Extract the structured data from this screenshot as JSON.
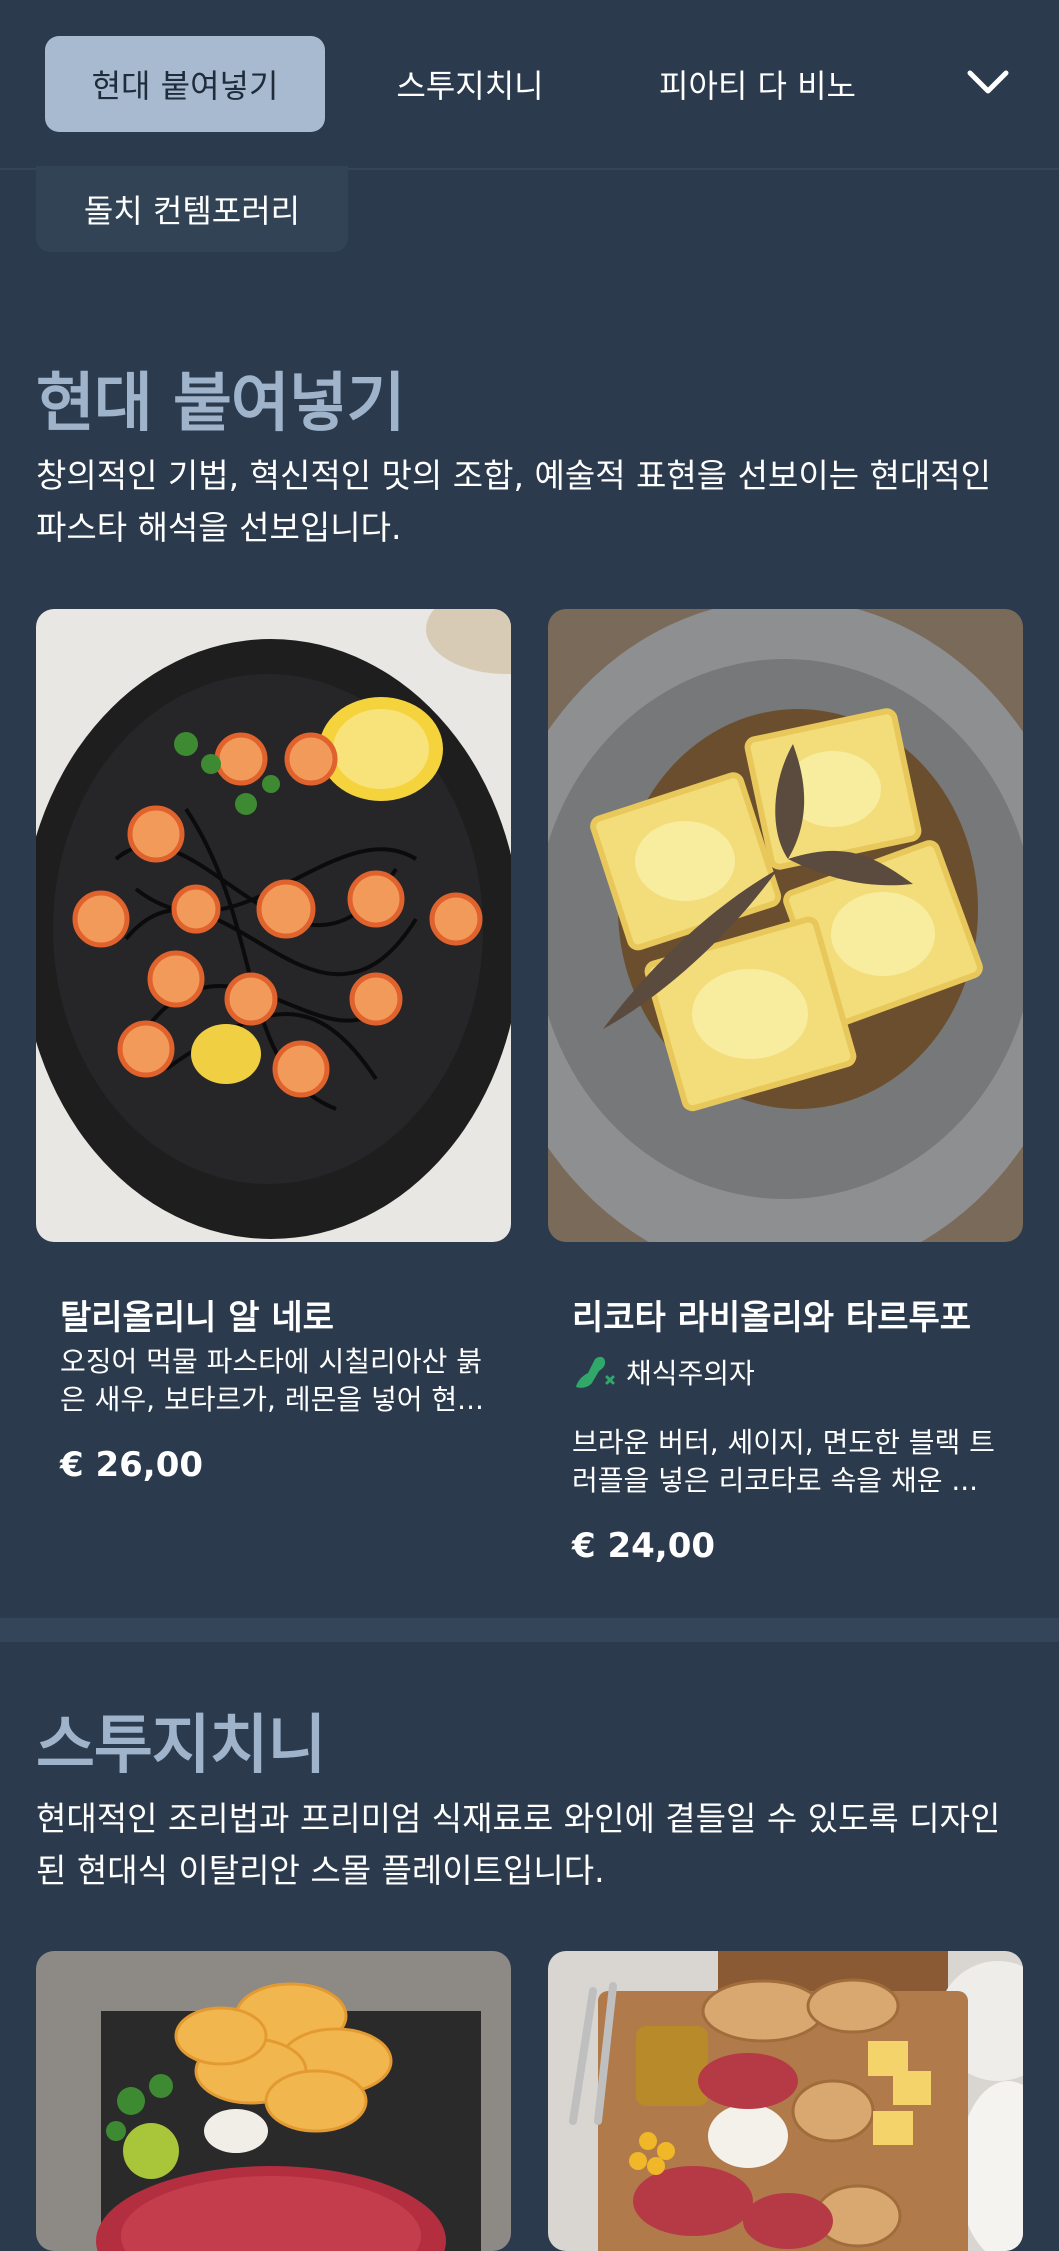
{
  "tabs": [
    {
      "label": "현대 붙여넣기",
      "active": true
    },
    {
      "label": "스투지치니",
      "active": false
    },
    {
      "label": "피아티 다 비노",
      "active": false
    }
  ],
  "tabs_more_icon": "chevron-down-icon",
  "overflow_chip": "돌치 컨템포러리",
  "sections": [
    {
      "title": "현대 붙여넣기",
      "description": "창의적인 기법, 혁신적인 맛의 조합, 예술적 표현을 선보이는 현대적인 파스타 해석을 선보입니다.",
      "items": [
        {
          "name": "탈리올리니 알 네로",
          "description": "오징어 먹물 파스타에 시칠리아산 붉은 새우, 보타르가, 레몬을 넣어 현...",
          "price": "€ 26,00"
        },
        {
          "name": "리코타 라비올리와 타르투포",
          "badge": "채식주의자",
          "badge_icon": "vegetarian-leg-icon",
          "description": "브라운 버터, 세이지, 면도한 블랙 트러플을 넣은 리코타로 속을 채운 ...",
          "price": "€ 24,00"
        }
      ]
    },
    {
      "title": "스투지치니",
      "description": "현대적인 조리법과 프리미엄 식재료로 와인에 곁들일 수 있도록 디자인된 현대식 이탈리안 스몰 플레이트입니다."
    }
  ],
  "colors": {
    "background": "#2b3a4c",
    "active_tab": "#a7bacf",
    "section_title": "#9fb3ca",
    "vegetarian_badge": "#2fa86a"
  }
}
